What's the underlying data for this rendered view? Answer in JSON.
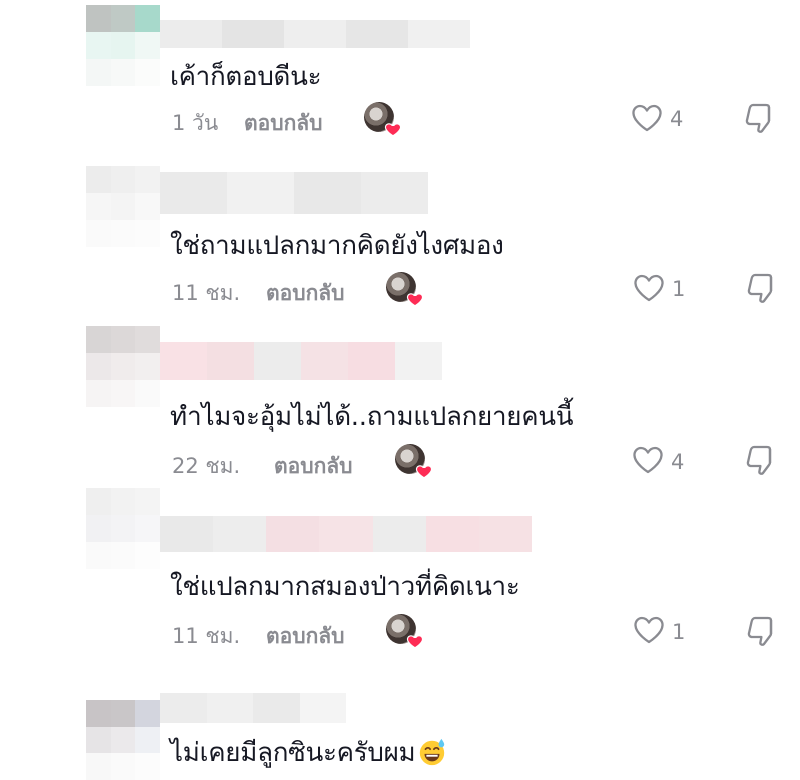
{
  "comments": [
    {
      "text": "เค้าก็ตอบดีนะ",
      "time": "1 วัน",
      "reply_label": "ตอบกลับ",
      "likes": "4",
      "creator_liked": true
    },
    {
      "text": "ใช่ถามแปลกมากคิดยังไงศมอง",
      "time": "11 ชม.",
      "reply_label": "ตอบกลับ",
      "likes": "1",
      "creator_liked": true
    },
    {
      "text": "ทำไมจะอุ้มไม่ได้..ถามแปลกยายคนนี้",
      "time": "22 ชม.",
      "reply_label": "ตอบกลับ",
      "likes": "4",
      "creator_liked": true
    },
    {
      "text": "ใช่แปลกมากสมองป่าวที่คิดเนาะ",
      "time": "11 ชม.",
      "reply_label": "ตอบกลับ",
      "likes": "1",
      "creator_liked": true
    },
    {
      "text": "ไม่เคยมีลูกซินะครับผม",
      "emoji": "sweat-smile-emoji"
    }
  ],
  "icons": {
    "like": "heart-outline-icon",
    "dislike": "thumbs-down-icon",
    "creator_like": "creator-heart-icon"
  },
  "colors": {
    "text": "#161823",
    "secondary": "#8a8b91",
    "heart": "#fe2c55"
  }
}
